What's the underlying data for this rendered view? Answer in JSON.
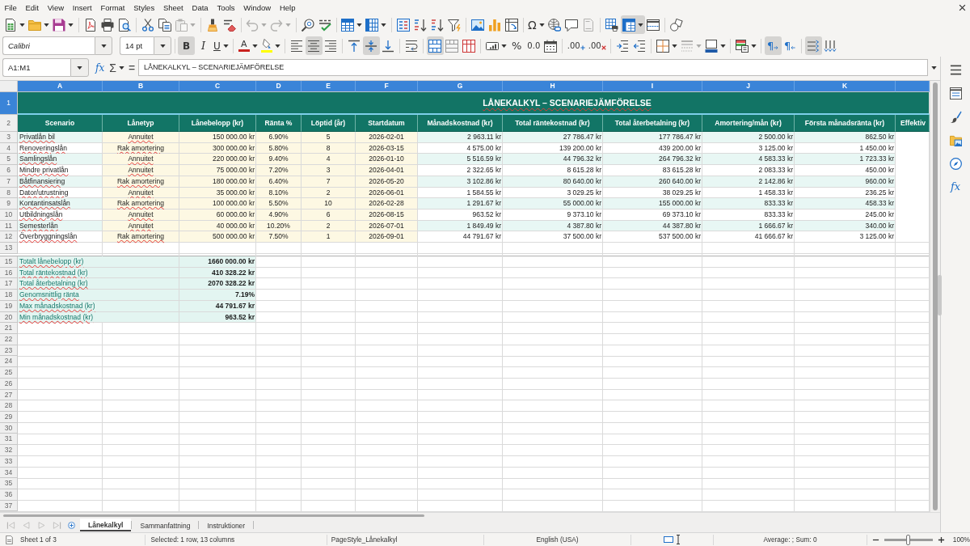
{
  "menu": [
    "File",
    "Edit",
    "View",
    "Insert",
    "Format",
    "Styles",
    "Sheet",
    "Data",
    "Tools",
    "Window",
    "Help"
  ],
  "standard_toolbar": [
    [
      {
        "kind": "new",
        "dropdown": true,
        "on": false,
        "disabled": false
      },
      {
        "kind": "open",
        "dropdown": true,
        "on": false,
        "disabled": false
      },
      {
        "kind": "save",
        "dropdown": true,
        "on": false,
        "disabled": false
      }
    ],
    [
      {
        "kind": "pdf",
        "on": false,
        "disabled": false
      },
      {
        "kind": "print",
        "on": false,
        "disabled": false
      },
      {
        "kind": "preview",
        "on": false,
        "disabled": false
      }
    ],
    [
      {
        "kind": "cut",
        "on": false,
        "disabled": false
      },
      {
        "kind": "copy",
        "on": false,
        "disabled": false
      },
      {
        "kind": "paste",
        "dropdown": true,
        "on": false,
        "disabled": true
      }
    ],
    [
      {
        "kind": "clone",
        "on": false,
        "disabled": false
      },
      {
        "kind": "clear",
        "on": false,
        "disabled": false
      }
    ],
    [
      {
        "kind": "undo",
        "dropdown": true,
        "on": false,
        "disabled": true
      },
      {
        "kind": "redo",
        "dropdown": true,
        "on": false,
        "disabled": true
      }
    ],
    [
      {
        "kind": "find",
        "on": false,
        "disabled": false
      },
      {
        "kind": "spell",
        "on": false,
        "disabled": false
      }
    ],
    [
      {
        "kind": "rows",
        "dropdown": true,
        "on": false,
        "disabled": false
      },
      {
        "kind": "cols",
        "dropdown": true,
        "on": false,
        "disabled": false
      }
    ],
    [
      {
        "kind": "sort",
        "on": false,
        "disabled": false
      },
      {
        "kind": "asc",
        "on": false,
        "disabled": false
      },
      {
        "kind": "desc",
        "on": false,
        "disabled": false
      },
      {
        "kind": "filter",
        "on": false,
        "disabled": false
      }
    ],
    [
      {
        "kind": "image",
        "on": false,
        "disabled": false
      },
      {
        "kind": "chart",
        "on": false,
        "disabled": false
      },
      {
        "kind": "pivot",
        "on": false,
        "disabled": false
      }
    ],
    [
      {
        "kind": "special",
        "label": "Ω",
        "dropdown": true,
        "on": false,
        "disabled": false
      },
      {
        "kind": "link",
        "on": false,
        "disabled": false
      },
      {
        "kind": "comment",
        "on": false,
        "disabled": false
      },
      {
        "kind": "headfoot",
        "on": false,
        "disabled": true
      }
    ],
    [
      {
        "kind": "range",
        "on": false,
        "disabled": false
      },
      {
        "kind": "freeze",
        "dropdown": true,
        "on": true,
        "disabled": false
      },
      {
        "kind": "split",
        "on": false,
        "disabled": false
      }
    ],
    [
      {
        "kind": "shapes",
        "on": false,
        "disabled": false
      }
    ]
  ],
  "font": {
    "name": "Calibri",
    "size": "14 pt"
  },
  "formatting_toolbar": [
    [
      {
        "kind": "bold",
        "label": "B",
        "on": true,
        "disabled": false
      },
      {
        "kind": "italic",
        "label": "I",
        "on": false,
        "disabled": false
      },
      {
        "kind": "underline",
        "label": "U",
        "dropdown": true,
        "on": false,
        "disabled": false
      }
    ],
    [
      {
        "kind": "fcolor",
        "label": "A",
        "color": "#c9211e",
        "dropdown": true,
        "on": false,
        "disabled": false
      },
      {
        "kind": "hilite",
        "color": "#ffff00",
        "dropdown": true,
        "on": false,
        "disabled": false
      }
    ],
    [
      {
        "kind": "al",
        "on": false,
        "disabled": false
      },
      {
        "kind": "ac",
        "on": true,
        "disabled": false
      },
      {
        "kind": "ar",
        "on": false,
        "disabled": false
      }
    ],
    [
      {
        "kind": "at",
        "on": false,
        "disabled": false
      },
      {
        "kind": "am",
        "on": true,
        "disabled": false
      },
      {
        "kind": "ab",
        "on": false,
        "disabled": false
      }
    ],
    [
      {
        "kind": "wrap",
        "on": false,
        "disabled": false
      }
    ],
    [
      {
        "kind": "mc",
        "on": true,
        "disabled": false
      },
      {
        "kind": "mg",
        "on": false,
        "disabled": false
      },
      {
        "kind": "um",
        "on": false,
        "disabled": false
      }
    ],
    [
      {
        "kind": "cur",
        "dropdown": true,
        "on": false,
        "disabled": false
      },
      {
        "kind": "pct",
        "label": "%",
        "on": false,
        "disabled": false
      },
      {
        "kind": "num",
        "label": "0.0",
        "on": false,
        "disabled": false
      },
      {
        "kind": "date",
        "on": false,
        "disabled": false
      }
    ],
    [
      {
        "kind": "adddec",
        "label": ".00",
        "on": false,
        "disabled": false
      },
      {
        "kind": "deldec",
        "label": ".00",
        "on": false,
        "disabled": false
      }
    ],
    [
      {
        "kind": "indent",
        "on": false,
        "disabled": false
      },
      {
        "kind": "outdent",
        "on": false,
        "disabled": false
      }
    ],
    [
      {
        "kind": "borders",
        "dropdown": true,
        "on": false,
        "disabled": false
      },
      {
        "kind": "bstyle",
        "dropdown": true,
        "on": false,
        "disabled": true
      },
      {
        "kind": "bcolor",
        "dropdown": true,
        "on": false,
        "disabled": false
      }
    ],
    [
      {
        "kind": "cond",
        "dropdown": true,
        "on": false,
        "disabled": false
      }
    ],
    [
      {
        "kind": "ltr",
        "label": "¶",
        "on": true,
        "disabled": false
      },
      {
        "kind": "rtl",
        "label": "¶",
        "on": false,
        "disabled": false
      }
    ],
    [
      {
        "kind": "tlr",
        "on": true,
        "disabled": false
      },
      {
        "kind": "ttb",
        "on": false,
        "disabled": false
      }
    ]
  ],
  "formula_bar": {
    "name_box": "A1:M1",
    "function_wizard": "fx",
    "sum": "Σ",
    "equals": "=",
    "formula": "LÅNEKALKYL – SCENARIEJÄMFÖRELSE"
  },
  "sheet": {
    "column_headers": [
      {
        "label": "A",
        "selected": true
      },
      {
        "label": "B",
        "selected": true
      },
      {
        "label": "C",
        "selected": true
      },
      {
        "label": "D",
        "selected": true
      },
      {
        "label": "E",
        "selected": true
      },
      {
        "label": "F",
        "selected": true
      },
      {
        "label": "G",
        "selected": true
      },
      {
        "label": "H",
        "selected": true
      },
      {
        "label": "I",
        "selected": true
      },
      {
        "label": "J",
        "selected": true
      },
      {
        "label": "K",
        "selected": true
      },
      {
        "selected": true
      }
    ],
    "rows": [
      {
        "number": "1",
        "selected": true,
        "kind": "title",
        "title": "LÅNEKALKYL – SCENARIEJÄMFÖRELSE"
      },
      {
        "number": "2",
        "selected": false,
        "kind": "header",
        "cells": [
          "Scenario",
          "Lånetyp",
          "Lånebelopp (kr)",
          "Ränta %",
          "Löptid (år)",
          "Startdatum",
          "Månadskostnad (kr)",
          "Total räntekostnad (kr)",
          "Total återbetalning (kr)",
          "Amortering/mån (kr)",
          "Första månadsränta (kr)",
          "Effektiv"
        ]
      },
      {
        "number": "3",
        "selected": false,
        "kind": "data",
        "cells": [
          "Privatlån bil",
          "Annuitet",
          "150 000.00 kr",
          "6.90%",
          "5",
          "2026-02-01",
          "2 963.11 kr",
          "27 786.47 kr",
          "177 786.47 kr",
          "2 500.00 kr",
          "862.50 kr"
        ]
      },
      {
        "number": "4",
        "selected": false,
        "kind": "data",
        "cells": [
          "Renoveringslån",
          "Rak amortering",
          "300 000.00 kr",
          "5.80%",
          "8",
          "2026-03-15",
          "4 575.00 kr",
          "139 200.00 kr",
          "439 200.00 kr",
          "3 125.00 kr",
          "1 450.00 kr"
        ]
      },
      {
        "number": "5",
        "selected": false,
        "kind": "data",
        "cells": [
          "Samlingslån",
          "Annuitet",
          "220 000.00 kr",
          "9.40%",
          "4",
          "2026-01-10",
          "5 516.59 kr",
          "44 796.32 kr",
          "264 796.32 kr",
          "4 583.33 kr",
          "1 723.33 kr"
        ]
      },
      {
        "number": "6",
        "selected": false,
        "kind": "data",
        "cells": [
          "Mindre privatlån",
          "Annuitet",
          "75 000.00 kr",
          "7.20%",
          "3",
          "2026-04-01",
          "2 322.65 kr",
          "8 615.28 kr",
          "83 615.28 kr",
          "2 083.33 kr",
          "450.00 kr"
        ]
      },
      {
        "number": "7",
        "selected": false,
        "kind": "data",
        "cells": [
          "Båtfinansiering",
          "Rak amortering",
          "180 000.00 kr",
          "6.40%",
          "7",
          "2026-05-20",
          "3 102.86 kr",
          "80 640.00 kr",
          "260 640.00 kr",
          "2 142.86 kr",
          "960.00 kr"
        ]
      },
      {
        "number": "8",
        "selected": false,
        "kind": "data",
        "cells": [
          "Dator/utrustning",
          "Annuitet",
          "35 000.00 kr",
          "8.10%",
          "2",
          "2026-06-01",
          "1 584.55 kr",
          "3 029.25 kr",
          "38 029.25 kr",
          "1 458.33 kr",
          "236.25 kr"
        ]
      },
      {
        "number": "9",
        "selected": false,
        "kind": "data",
        "cells": [
          "Kontantinsatslån",
          "Rak amortering",
          "100 000.00 kr",
          "5.50%",
          "10",
          "2026-02-28",
          "1 291.67 kr",
          "55 000.00 kr",
          "155 000.00 kr",
          "833.33 kr",
          "458.33 kr"
        ]
      },
      {
        "number": "10",
        "selected": false,
        "kind": "data",
        "cells": [
          "Utbildningslån",
          "Annuitet",
          "60 000.00 kr",
          "4.90%",
          "6",
          "2026-08-15",
          "963.52 kr",
          "9 373.10 kr",
          "69 373.10 kr",
          "833.33 kr",
          "245.00 kr"
        ]
      },
      {
        "number": "11",
        "selected": false,
        "kind": "data",
        "cells": [
          "Semesterlån",
          "Annuitet",
          "40 000.00 kr",
          "10.20%",
          "2",
          "2026-07-01",
          "1 849.49 kr",
          "4 387.80 kr",
          "44 387.80 kr",
          "1 666.67 kr",
          "340.00 kr"
        ]
      },
      {
        "number": "12",
        "selected": false,
        "kind": "data",
        "cells": [
          "Överbryggningslån",
          "Rak amortering",
          "500 000.00 kr",
          "7.50%",
          "1",
          "2026-09-01",
          "44 791.67 kr",
          "37 500.00 kr",
          "537 500.00 kr",
          "41 666.67 kr",
          "3 125.00 kr"
        ]
      },
      {
        "number": "13",
        "selected": false,
        "kind": "blank"
      },
      {
        "kind": "hidden"
      },
      {
        "number": "15",
        "selected": false,
        "kind": "summary",
        "label": "Totalt lånebelopp (kr)",
        "value": "1660 000.00 kr"
      },
      {
        "number": "16",
        "selected": false,
        "kind": "summary",
        "label": "Total räntekostnad (kr)",
        "value": "410 328.22 kr"
      },
      {
        "number": "17",
        "selected": false,
        "kind": "summary",
        "label": "Total återbetalning (kr)",
        "value": "2070 328.22 kr"
      },
      {
        "number": "18",
        "selected": false,
        "kind": "summary",
        "label": "Genomsnittlig ränta",
        "value": "7.19%"
      },
      {
        "number": "19",
        "selected": false,
        "kind": "summary",
        "label": "Max månadskostnad (kr)",
        "value": "44 791.67 kr"
      },
      {
        "number": "20",
        "selected": false,
        "kind": "summary",
        "label": "Min månadskostnad (kr)",
        "value": "963.52 kr"
      },
      {
        "number": "21",
        "selected": false,
        "kind": "blank"
      },
      {
        "number": "22",
        "selected": false,
        "kind": "blank"
      },
      {
        "number": "23",
        "selected": false,
        "kind": "blank"
      },
      {
        "number": "24",
        "selected": false,
        "kind": "blank"
      },
      {
        "number": "25",
        "selected": false,
        "kind": "blank"
      },
      {
        "number": "26",
        "selected": false,
        "kind": "blank"
      },
      {
        "number": "27",
        "selected": false,
        "kind": "blank"
      },
      {
        "number": "28",
        "selected": false,
        "kind": "blank"
      },
      {
        "number": "29",
        "selected": false,
        "kind": "blank"
      },
      {
        "number": "30",
        "selected": false,
        "kind": "blank"
      },
      {
        "number": "31",
        "selected": false,
        "kind": "blank"
      },
      {
        "number": "32",
        "selected": false,
        "kind": "blank"
      },
      {
        "number": "33",
        "selected": false,
        "kind": "blank"
      },
      {
        "number": "34",
        "selected": false,
        "kind": "blank"
      },
      {
        "number": "35",
        "selected": false,
        "kind": "blank"
      },
      {
        "number": "36",
        "selected": false,
        "kind": "blank"
      },
      {
        "number": "37",
        "selected": false,
        "kind": "blank"
      }
    ]
  },
  "sheet_navigation": [
    {
      "kind": "first",
      "disabled": true
    },
    {
      "kind": "prev",
      "disabled": true
    },
    {
      "kind": "next",
      "disabled": true
    },
    {
      "kind": "last",
      "disabled": true
    }
  ],
  "sheet_tabs": [
    {
      "label": "Lånekalkyl",
      "selected": true
    },
    {
      "label": "Sammanfattning",
      "selected": false
    },
    {
      "label": "Instruktioner",
      "selected": false
    }
  ],
  "sidebar": [
    {
      "kind": "menu"
    },
    {
      "kind": "props"
    },
    {
      "kind": "styles"
    },
    {
      "kind": "gallery"
    },
    {
      "kind": "nav"
    },
    {
      "kind": "functions",
      "label": "fx"
    }
  ],
  "status_bar": {
    "sheet": "Sheet 1 of 3",
    "selection": "Selected: 1 row, 13 columns",
    "page_style": "PageStyle_Lånekalkyl",
    "language": "English (USA)",
    "aggregates": "Average: ; Sum: 0",
    "zoom": {
      "level": 0.5,
      "percent": "100%"
    }
  }
}
